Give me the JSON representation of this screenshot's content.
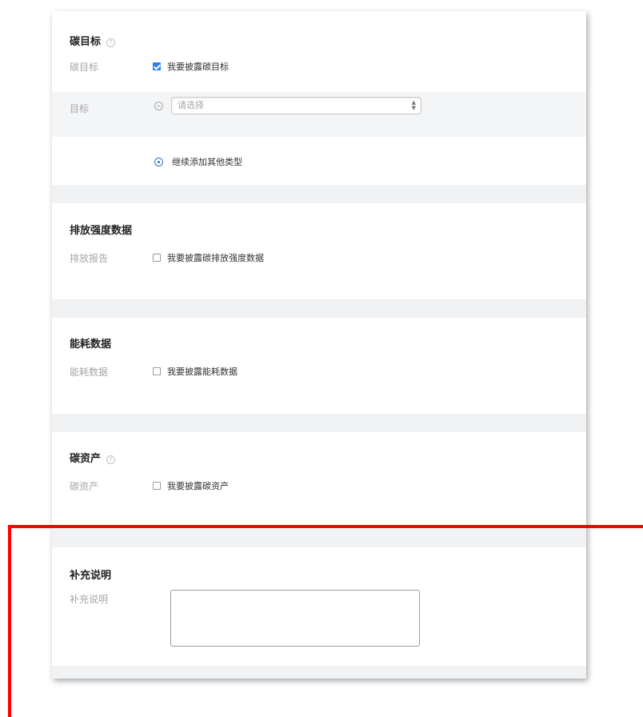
{
  "carbon_target": {
    "title": "碳目标",
    "row_label": "碳目标",
    "checkbox_label": "我要披露碳目标",
    "checked": true,
    "target_label": "目标",
    "select_placeholder": "请选择",
    "add_more_label": "继续添加其他类型"
  },
  "emission_intensity": {
    "title": "排放强度数据",
    "row_label": "排放报告",
    "checkbox_label": "我要披露碳排放强度数据",
    "checked": false
  },
  "energy": {
    "title": "能耗数据",
    "row_label": "能耗数据",
    "checkbox_label": "我要披露能耗数据",
    "checked": false
  },
  "carbon_assets": {
    "title": "碳资产",
    "row_label": "碳资产",
    "checkbox_label": "我要披露碳资产",
    "checked": false
  },
  "supplement": {
    "title": "补充说明",
    "row_label": "补充说明",
    "text_value": ""
  },
  "icons": {
    "help": "question-circle-icon",
    "remove": "minus-circle-icon",
    "add": "plus-circle-icon",
    "select_arrow": "sort-arrows-icon"
  },
  "colors": {
    "accent": "#2f80ed",
    "highlight_border": "#ff0000"
  }
}
